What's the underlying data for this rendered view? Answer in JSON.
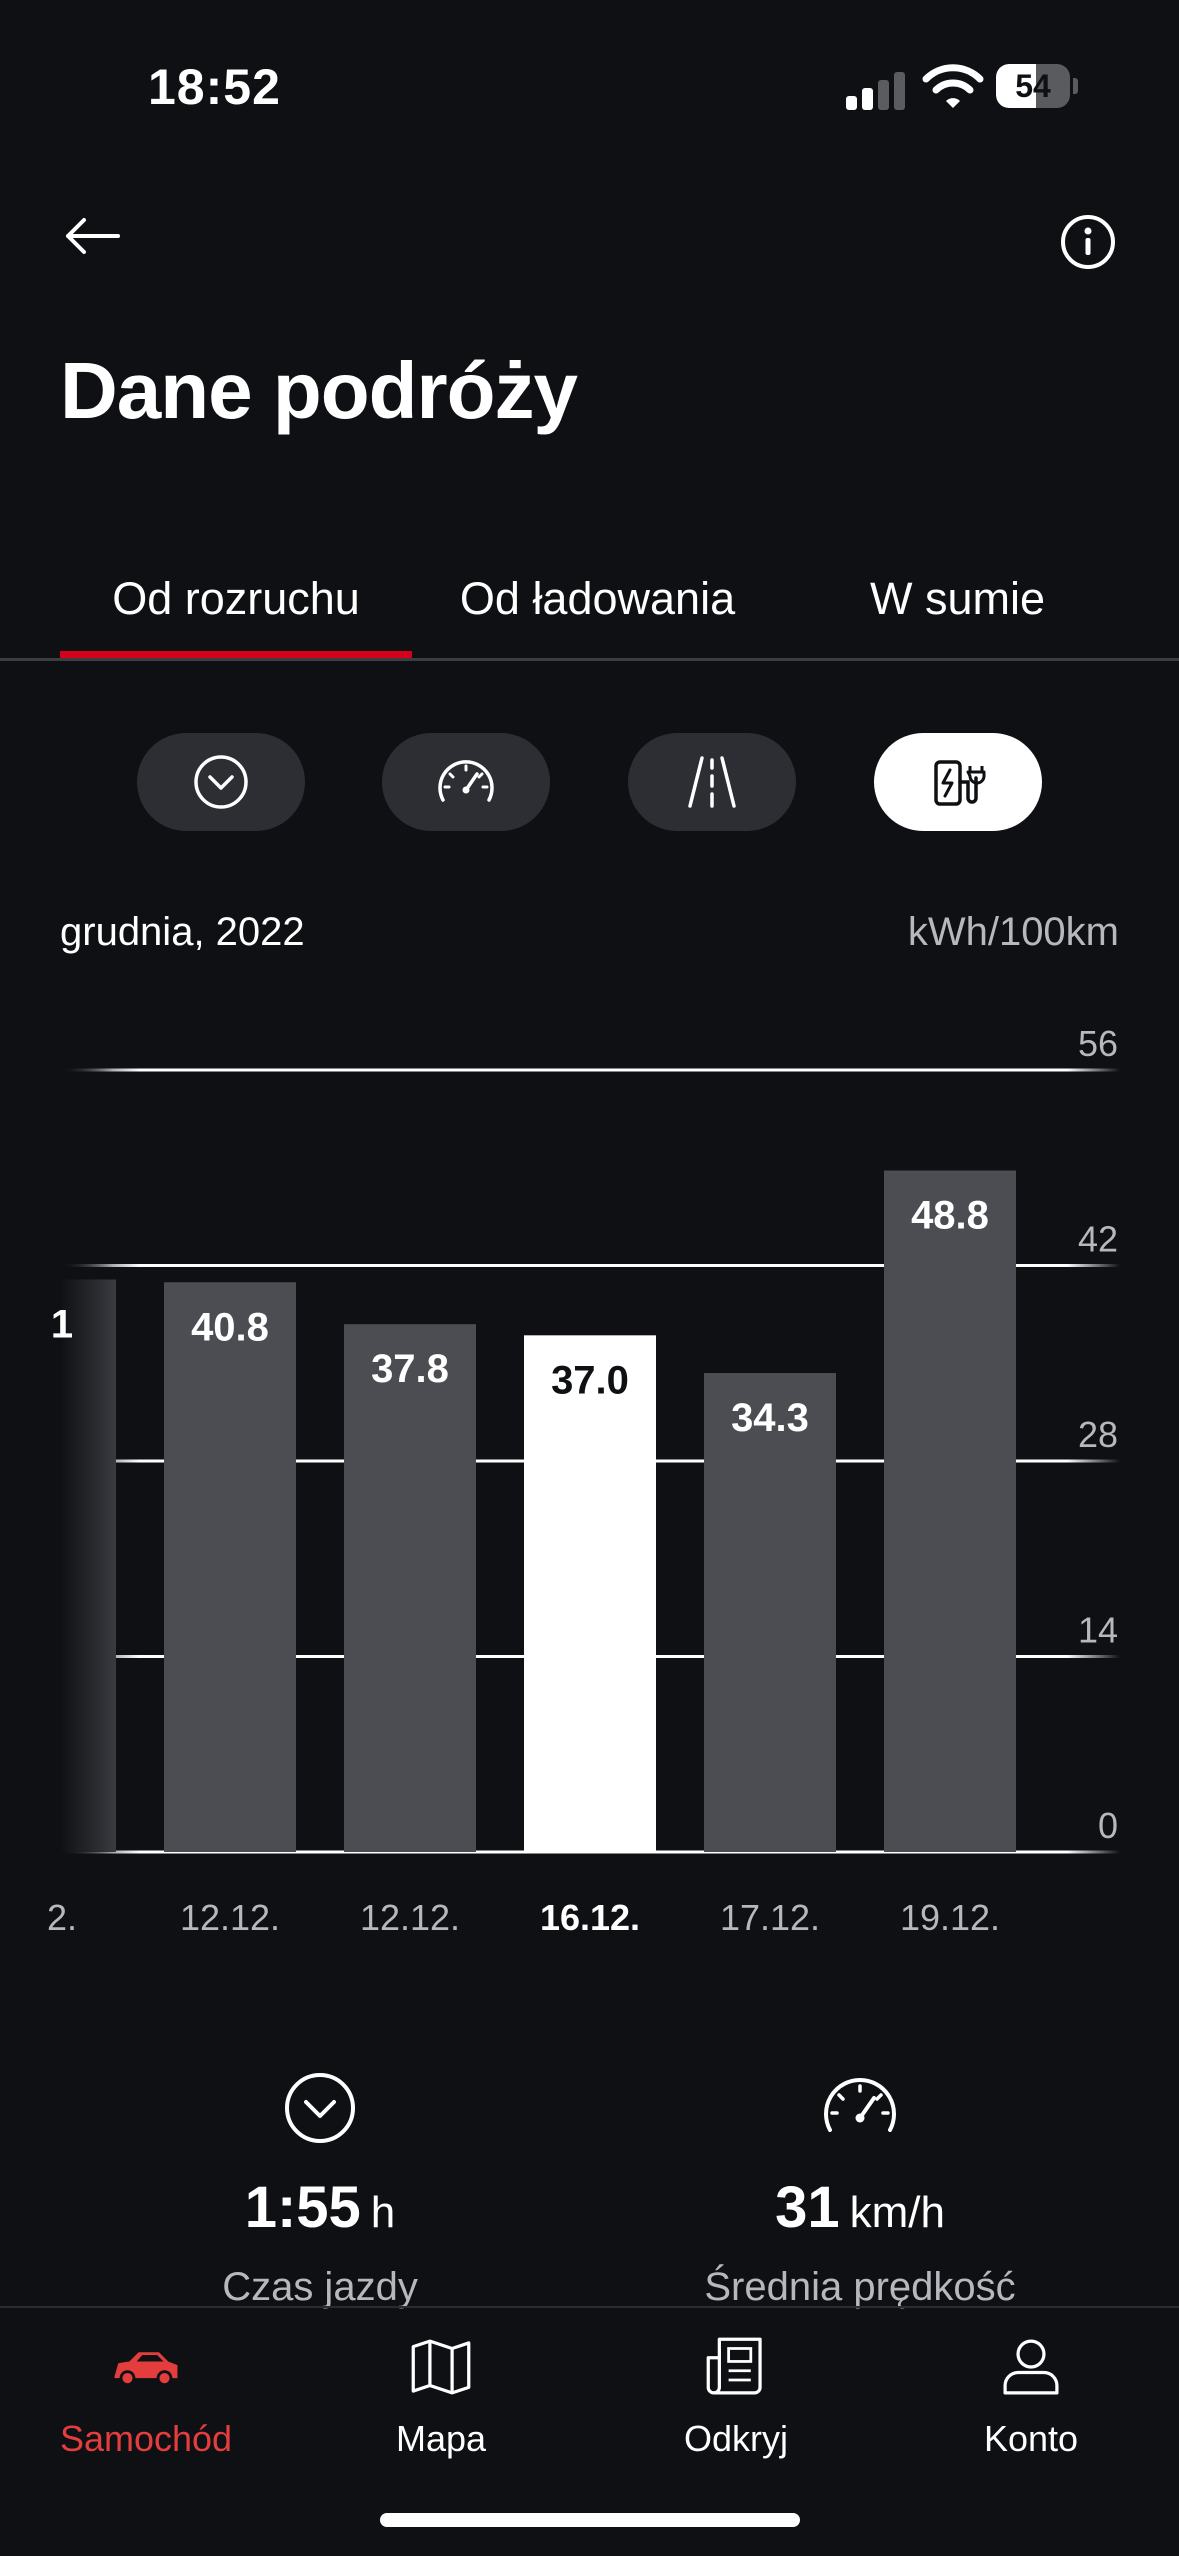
{
  "status_bar": {
    "time": "18:52",
    "battery_level": "54"
  },
  "header": {
    "title": "Dane podróży",
    "back_icon": "arrow-left-icon",
    "info_icon": "info-circle-icon"
  },
  "tabs": [
    {
      "label": "Od rozruchu",
      "active": true
    },
    {
      "label": "Od ładowania",
      "active": false
    },
    {
      "label": "W sumie",
      "active": false
    }
  ],
  "filters": [
    {
      "icon": "chevron-circle-icon",
      "active": false
    },
    {
      "icon": "speedometer-icon",
      "active": false
    },
    {
      "icon": "road-icon",
      "active": false
    },
    {
      "icon": "charging-station-icon",
      "active": true
    }
  ],
  "chart_header": {
    "month": "grudnia, 2022",
    "unit": "kWh/100km"
  },
  "chart_data": {
    "type": "bar",
    "categories": [
      "2.",
      "12.12.",
      "12.12.",
      "16.12.",
      "17.12.",
      "19.12."
    ],
    "values": [
      41,
      40.8,
      37.8,
      37.0,
      34.3,
      48.8
    ],
    "data_labels": [
      "1",
      "40.8",
      "37.8",
      "37.0",
      "34.3",
      "48.8"
    ],
    "selected_index": 3,
    "ylim": [
      0,
      56
    ],
    "yticks": [
      "0",
      "14",
      "28",
      "42",
      "56"
    ],
    "grid": true,
    "first_bar_partial": true,
    "colors": {
      "bar": "#4b4d52",
      "selected": "#ffffff",
      "label": "#ffffff",
      "selected_label": "#0e1014"
    }
  },
  "stats": [
    {
      "icon": "chevron-circle-icon",
      "value": "1:55",
      "unit": "h",
      "label": "Czas jazdy"
    },
    {
      "icon": "speedometer-icon",
      "value": "31",
      "unit": "km/h",
      "label": "Średnia prędkość"
    }
  ],
  "bottom_nav": [
    {
      "label": "Samochód",
      "icon": "car-icon",
      "active": true
    },
    {
      "label": "Mapa",
      "icon": "map-icon",
      "active": false
    },
    {
      "label": "Odkryj",
      "icon": "news-icon",
      "active": false
    },
    {
      "label": "Konto",
      "icon": "user-icon",
      "active": false
    }
  ],
  "colors": {
    "accent": "#d5001c",
    "nav_active": "#e43d3d",
    "background": "#0e1014"
  }
}
